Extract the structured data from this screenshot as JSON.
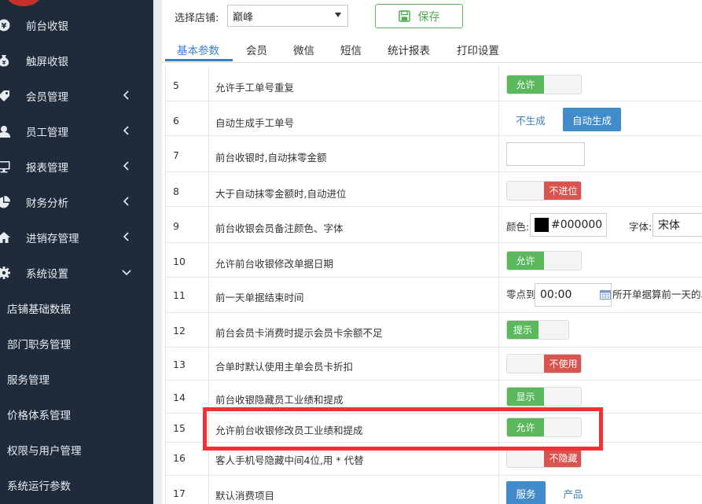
{
  "sidebar": {
    "items": [
      {
        "label": "前台收银",
        "icon": "yen-icon"
      },
      {
        "label": "触屏收银",
        "icon": "moneybag-icon"
      },
      {
        "label": "会员管理",
        "icon": "tag-icon"
      },
      {
        "label": "员工管理",
        "icon": "user-icon"
      },
      {
        "label": "报表管理",
        "icon": "monitor-icon"
      },
      {
        "label": "财务分析",
        "icon": "pie-chart-icon"
      },
      {
        "label": "进销存管理",
        "icon": "home-icon"
      },
      {
        "label": "系统设置",
        "icon": "gear-icon"
      }
    ],
    "subitems": [
      "店铺基础数据",
      "部门职务管理",
      "服务管理",
      "价格体系管理",
      "权限与用户管理",
      "系统运行参数"
    ]
  },
  "toolbar": {
    "store_label": "选择店铺:",
    "store_value": "巅峰",
    "save_label": "保存"
  },
  "tabs": [
    "基本参数",
    "会员",
    "微信",
    "短信",
    "统计报表",
    "打印设置"
  ],
  "rows": [
    {
      "num": "5",
      "label": "允许手工单号重复",
      "control": "允许"
    },
    {
      "num": "6",
      "label": "自动生成手工单号",
      "options": [
        "不生成",
        "自动生成"
      ]
    },
    {
      "num": "7",
      "label": "前台收银时,自动抹零金额",
      "value": ""
    },
    {
      "num": "8",
      "label": "大于自动抹零金额时,自动进位",
      "control": "不进位"
    },
    {
      "num": "9",
      "label": "前台收银会员备注颜色、字体",
      "color_label": "颜色:",
      "color_value": "#000000",
      "font_label": "字体:",
      "font_value": "宋体"
    },
    {
      "num": "10",
      "label": "允许前台收银修改单据日期",
      "control": "允许"
    },
    {
      "num": "11",
      "label": "前一天单据结束时间",
      "prefix": "零点到",
      "value": "00:00",
      "suffix": "所开单据算前一天的单"
    },
    {
      "num": "12",
      "label": "前台会员卡消费时提示会员卡余额不足",
      "control": "提示"
    },
    {
      "num": "13",
      "label": "合单时默认使用主单会员卡折扣",
      "control": "不使用"
    },
    {
      "num": "14",
      "label": "前台收银隐藏员工业绩和提成",
      "control": "显示"
    },
    {
      "num": "15",
      "label": "允许前台收银修改员工业绩和提成",
      "control": "允许"
    },
    {
      "num": "16",
      "label": "客人手机号隐藏中间4位,用 * 代替",
      "control": "不隐藏"
    },
    {
      "num": "17",
      "label": "默认消费项目",
      "options": [
        "服务",
        "产品"
      ]
    }
  ],
  "colors": {
    "sidebar_bg": "#1f2a3a",
    "accent": "#3a7fc4",
    "toggle_on": "#5cb85c",
    "toggle_off": "#d9534f",
    "highlight": "#f03232"
  }
}
